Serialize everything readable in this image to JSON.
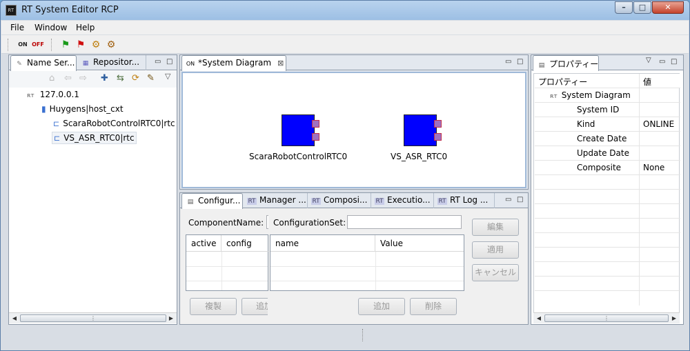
{
  "window": {
    "title": "RT System Editor RCP",
    "icon": "rt-app-icon",
    "controls": [
      "minimize",
      "maximize",
      "close"
    ]
  },
  "menubar": {
    "items": [
      "File",
      "Window",
      "Help"
    ]
  },
  "toolbar": {
    "buttons": [
      {
        "name": "all-on-button",
        "label": "ON"
      },
      {
        "name": "all-off-button",
        "label": "OFF"
      },
      {
        "name": "all-start-button",
        "icon": "green-flag-icon"
      },
      {
        "name": "all-stop-button",
        "icon": "red-flag-icon"
      },
      {
        "name": "all-activate-button",
        "icon": "gear-icon"
      },
      {
        "name": "all-deactivate-button",
        "icon": "gear-icon"
      }
    ]
  },
  "left_panel": {
    "tabs": [
      "Name Ser...",
      "Repositor..."
    ],
    "tree": {
      "root": "127.0.0.1",
      "host": "Huygens|host_cxt",
      "items": [
        "ScaraRobotControlRTC0|rtc",
        "VS_ASR_RTC0|rtc"
      ]
    }
  },
  "editor": {
    "tab": "*System Diagram",
    "components": [
      "ScaraRobotControlRTC0",
      "VS_ASR_RTC0"
    ]
  },
  "bottom_panel": {
    "tabs": [
      "Configur...",
      "Manager ...",
      "Composi...",
      "Executio...",
      "RT Log ..."
    ],
    "component_name_label": "ComponentName:",
    "configuration_set_label": "ConfigurationSet:",
    "left_table_headers": [
      "active",
      "config"
    ],
    "right_table_headers": [
      "name",
      "Value"
    ],
    "buttons": {
      "edit": "編集",
      "apply": "適用",
      "cancel": "キャンセル",
      "duplicate": "複製",
      "add_left": "追加",
      "add": "追加",
      "delete": "削除"
    }
  },
  "properties": {
    "tab": "プロパティー",
    "headers": [
      "プロパティー",
      "値"
    ],
    "root": "System Diagram",
    "rows": [
      {
        "key": "System ID",
        "value": ""
      },
      {
        "key": "Kind",
        "value": "ONLINE"
      },
      {
        "key": "Create Date",
        "value": ""
      },
      {
        "key": "Update Date",
        "value": ""
      },
      {
        "key": "Composite",
        "value": "None"
      }
    ]
  },
  "colors": {
    "component_fill": "#0000ff",
    "port_fill": "#a070c0",
    "titlebar": "#b9d3ee"
  }
}
